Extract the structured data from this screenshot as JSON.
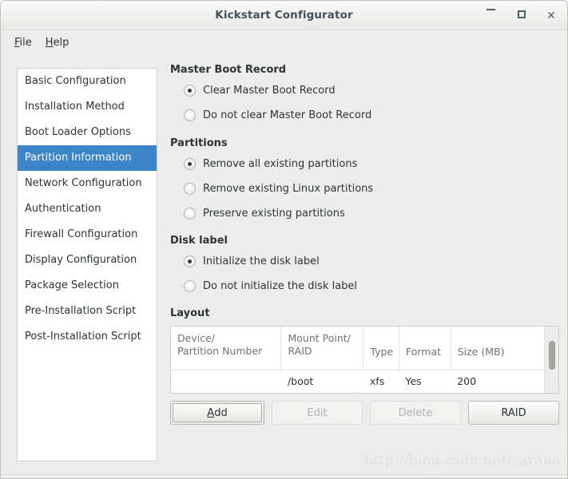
{
  "window": {
    "title": "Kickstart Configurator",
    "controls": {
      "minimize": "minimize-icon",
      "maximize": "maximize-icon",
      "close": "✕"
    }
  },
  "menubar": {
    "items": [
      {
        "label": "File",
        "mnemonic": "F",
        "rest": "ile"
      },
      {
        "label": "Help",
        "mnemonic": "H",
        "rest": "elp"
      }
    ]
  },
  "sidebar": {
    "selected_index": 3,
    "items": [
      {
        "label": "Basic Configuration"
      },
      {
        "label": "Installation Method"
      },
      {
        "label": "Boot Loader Options"
      },
      {
        "label": "Partition Information"
      },
      {
        "label": "Network Configuration"
      },
      {
        "label": "Authentication"
      },
      {
        "label": "Firewall Configuration"
      },
      {
        "label": "Display Configuration"
      },
      {
        "label": "Package Selection"
      },
      {
        "label": "Pre-Installation Script"
      },
      {
        "label": "Post-Installation Script"
      }
    ]
  },
  "main": {
    "groups": [
      {
        "title": "Master Boot Record",
        "options": [
          {
            "label": "Clear Master Boot Record",
            "checked": true
          },
          {
            "label": "Do not clear Master Boot Record",
            "checked": false
          }
        ]
      },
      {
        "title": "Partitions",
        "options": [
          {
            "label": "Remove all existing partitions",
            "checked": true
          },
          {
            "label": "Remove existing Linux partitions",
            "checked": false
          },
          {
            "label": "Preserve existing partitions",
            "checked": false
          }
        ]
      },
      {
        "title": "Disk label",
        "options": [
          {
            "label": "Initialize the disk label",
            "checked": true
          },
          {
            "label": "Do not initialize the disk label",
            "checked": false
          }
        ]
      }
    ],
    "layout": {
      "title": "Layout",
      "columns": [
        "Device/\nPartition Number",
        "Mount Point/\nRAID",
        "Type",
        "Format",
        "Size (MB)"
      ],
      "columns_flat": {
        "device_line1": "Device/",
        "device_line2": "Partition Number",
        "mount_line1": "Mount Point/",
        "mount_line2": "RAID",
        "type": "Type",
        "format": "Format",
        "size": "Size (MB)"
      },
      "rows": [
        {
          "device": "",
          "mount": "/boot",
          "type": "xfs",
          "format": "Yes",
          "size": "200"
        }
      ],
      "buttons": [
        {
          "label": "Add",
          "mnemonic": "A",
          "rest": "dd",
          "state": "focused"
        },
        {
          "label": "Edit",
          "state": "disabled"
        },
        {
          "label": "Delete",
          "state": "disabled"
        },
        {
          "label": "RAID",
          "state": "normal"
        }
      ]
    }
  },
  "watermark": {
    "text": "http://blog.csdn.net/sarauo"
  },
  "colors": {
    "selection": "#3c85c8",
    "window_bg": "#ededed",
    "text": "#2e3436",
    "title_text": "#40525b"
  }
}
